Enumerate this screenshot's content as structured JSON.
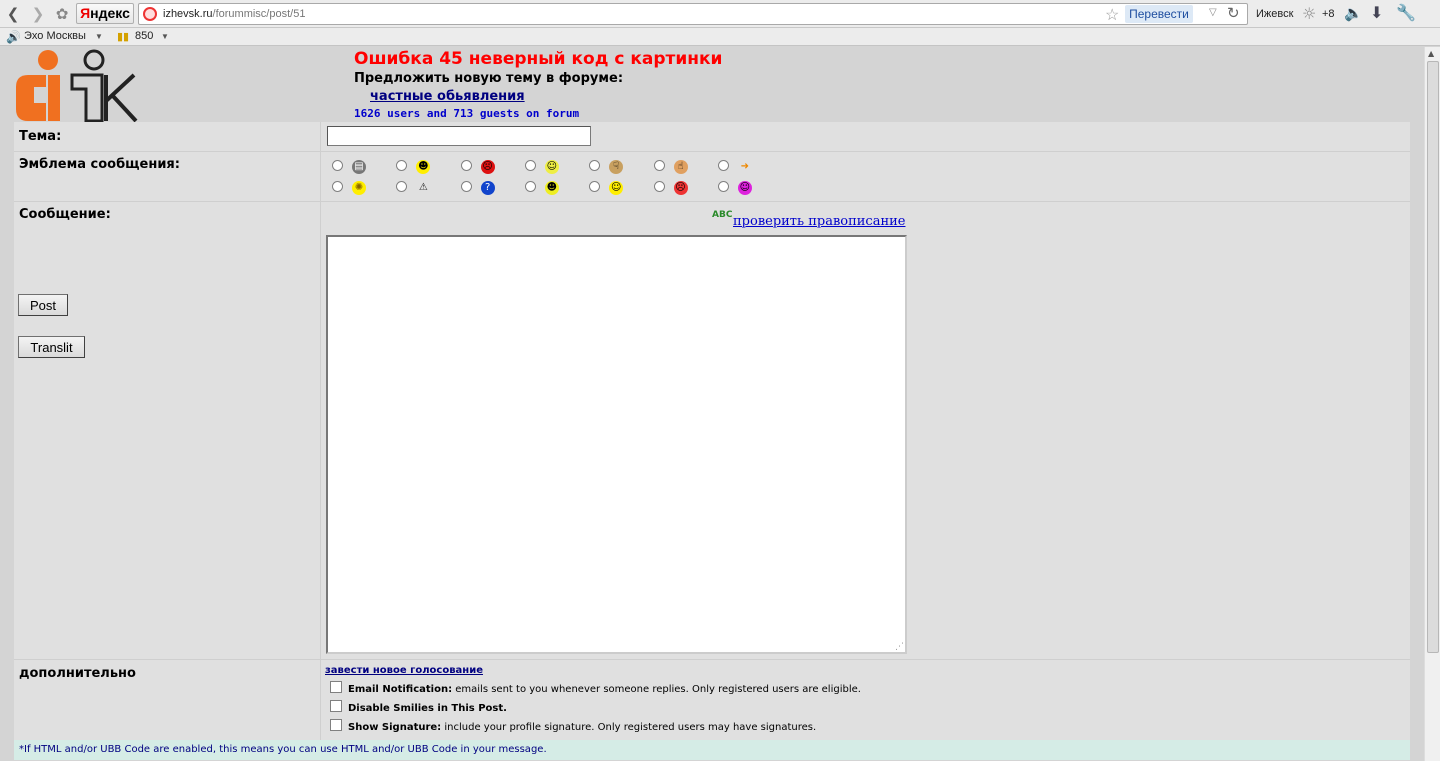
{
  "browser": {
    "yandex_label_y": "Я",
    "yandex_label_rest": "ндекс",
    "url_host": "izhevsk.ru",
    "url_path": "/forummisc/post/51",
    "translate_label": "Перевести",
    "city": "Ижевск",
    "temperature": "+8",
    "icons": [
      "back-icon",
      "forward-icon",
      "extensions-icon",
      "star-icon",
      "reload-icon",
      "sun-icon",
      "speaker-icon",
      "download-icon",
      "wrench-icon"
    ]
  },
  "bookmarks": {
    "radio_label": "Эхо Москвы",
    "counter_label": "850"
  },
  "header": {
    "title": "Ошибка 45 неверный код с картинки",
    "subtitle": "Предложить новую тему в форуме:",
    "forum_link": "частные обьявления",
    "users_online": "1626 users and 713 guests on forum"
  },
  "form": {
    "subject_label": "Тема:",
    "subject_value": "",
    "emblem_label": "Эмблема сообщения:",
    "message_label": "Сообщение:",
    "spellcheck_icon": "ABC",
    "spellcheck_link": "проверить правописание",
    "message_value": "",
    "post_button": "Post",
    "translit_button": "Translit",
    "extra_label": "дополнительно",
    "poll_link": "завести новое голосование",
    "options": [
      {
        "title": "Email Notification:",
        "desc": " emails sent to you whenever someone replies. Only registered users are eligible."
      },
      {
        "title": "Disable Smilies in This Post.",
        "desc": ""
      },
      {
        "title": "Show Signature:",
        "desc": " include your profile signature. Only registered users may have signatures."
      }
    ],
    "footer_note": "*If HTML and/or UBB Code are enabled, this means you can use HTML and/or UBB Code in your message."
  },
  "emblems": [
    {
      "name": "page-icon",
      "glyph": "▤",
      "color": "#777777",
      "fg": "#ffffff"
    },
    {
      "name": "happy-face-icon",
      "glyph": "☻",
      "color": "#ffee00",
      "fg": "#000000"
    },
    {
      "name": "angry-face-icon",
      "glyph": "☹",
      "color": "#dd1111",
      "fg": "#000000"
    },
    {
      "name": "wink-face-icon",
      "glyph": "☺",
      "color": "#eeee44",
      "fg": "#000000"
    },
    {
      "name": "thumbs-down-icon",
      "glyph": "☟",
      "color": "#c8a060",
      "fg": "#000000"
    },
    {
      "name": "thumbs-up-icon",
      "glyph": "☝",
      "color": "#e0a060",
      "fg": "#000000"
    },
    {
      "name": "arrow-right-icon",
      "glyph": "➜",
      "color": "transparent",
      "fg": "#ee8800"
    },
    {
      "name": "lightbulb-icon",
      "glyph": "✺",
      "color": "#ffee00",
      "fg": "#886600"
    },
    {
      "name": "warning-icon",
      "glyph": "⚠",
      "color": "transparent",
      "fg": "#222222"
    },
    {
      "name": "question-icon",
      "glyph": "?",
      "color": "#1144cc",
      "fg": "#ffffff"
    },
    {
      "name": "cool-face-icon",
      "glyph": "☻",
      "color": "#eeee22",
      "fg": "#000000"
    },
    {
      "name": "smile-face-icon",
      "glyph": "☺",
      "color": "#ffee00",
      "fg": "#000000"
    },
    {
      "name": "sad-face-icon",
      "glyph": "☹",
      "color": "#ee3333",
      "fg": "#000000"
    },
    {
      "name": "purple-face-icon",
      "glyph": "☺",
      "color": "#dd22dd",
      "fg": "#000000"
    }
  ]
}
